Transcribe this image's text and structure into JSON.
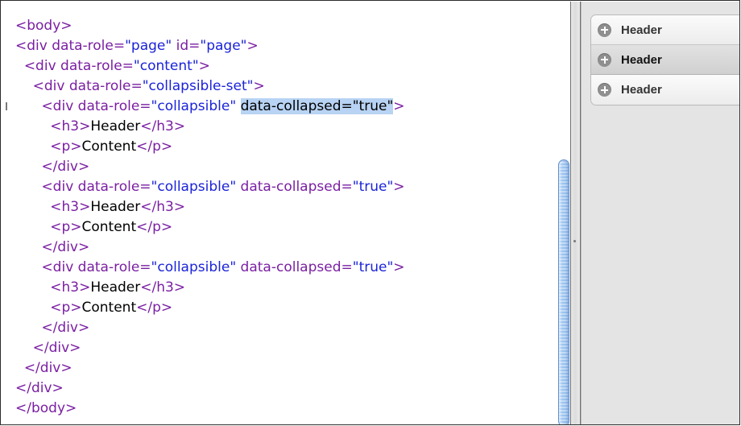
{
  "editor": {
    "lines": [
      [
        {
          "t": "tag",
          "v": "<body>"
        }
      ],
      [
        {
          "t": "tag",
          "v": "<div "
        },
        {
          "t": "attr",
          "v": "data-role="
        },
        {
          "t": "val",
          "v": "\"page\""
        },
        {
          "t": "attr",
          "v": " id="
        },
        {
          "t": "val",
          "v": "\"page\""
        },
        {
          "t": "tag",
          "v": ">"
        }
      ],
      [
        {
          "t": "text",
          "v": "  "
        },
        {
          "t": "tag",
          "v": "<div "
        },
        {
          "t": "attr",
          "v": "data-role="
        },
        {
          "t": "val",
          "v": "\"content\""
        },
        {
          "t": "tag",
          "v": ">"
        }
      ],
      [
        {
          "t": "text",
          "v": "    "
        },
        {
          "t": "tag",
          "v": "<div "
        },
        {
          "t": "attr",
          "v": "data-role="
        },
        {
          "t": "val",
          "v": "\"collapsible-set\""
        },
        {
          "t": "tag",
          "v": ">"
        }
      ],
      [
        {
          "t": "text",
          "v": "      "
        },
        {
          "t": "tag",
          "v": "<div "
        },
        {
          "t": "attr",
          "v": "data-role="
        },
        {
          "t": "val",
          "v": "\"collapsible\""
        },
        {
          "t": "text",
          "v": " "
        },
        {
          "t": "sel",
          "v": "data-collapsed=\"true\""
        },
        {
          "t": "tag",
          "v": ">"
        }
      ],
      [
        {
          "t": "text",
          "v": "        "
        },
        {
          "t": "tag",
          "v": "<h3>"
        },
        {
          "t": "text",
          "v": "Header"
        },
        {
          "t": "tag",
          "v": "</h3>"
        }
      ],
      [
        {
          "t": "text",
          "v": "        "
        },
        {
          "t": "tag",
          "v": "<p>"
        },
        {
          "t": "text",
          "v": "Content"
        },
        {
          "t": "tag",
          "v": "</p>"
        }
      ],
      [
        {
          "t": "text",
          "v": "      "
        },
        {
          "t": "tag",
          "v": "</div>"
        }
      ],
      [
        {
          "t": "text",
          "v": "      "
        },
        {
          "t": "tag",
          "v": "<div "
        },
        {
          "t": "attr",
          "v": "data-role="
        },
        {
          "t": "val",
          "v": "\"collapsible\""
        },
        {
          "t": "attr",
          "v": " data-collapsed="
        },
        {
          "t": "val",
          "v": "\"true\""
        },
        {
          "t": "tag",
          "v": ">"
        }
      ],
      [
        {
          "t": "text",
          "v": "        "
        },
        {
          "t": "tag",
          "v": "<h3>"
        },
        {
          "t": "text",
          "v": "Header"
        },
        {
          "t": "tag",
          "v": "</h3>"
        }
      ],
      [
        {
          "t": "text",
          "v": "        "
        },
        {
          "t": "tag",
          "v": "<p>"
        },
        {
          "t": "text",
          "v": "Content"
        },
        {
          "t": "tag",
          "v": "</p>"
        }
      ],
      [
        {
          "t": "text",
          "v": "      "
        },
        {
          "t": "tag",
          "v": "</div>"
        }
      ],
      [
        {
          "t": "text",
          "v": "      "
        },
        {
          "t": "tag",
          "v": "<div "
        },
        {
          "t": "attr",
          "v": "data-role="
        },
        {
          "t": "val",
          "v": "\"collapsible\""
        },
        {
          "t": "attr",
          "v": " data-collapsed="
        },
        {
          "t": "val",
          "v": "\"true\""
        },
        {
          "t": "tag",
          "v": ">"
        }
      ],
      [
        {
          "t": "text",
          "v": "        "
        },
        {
          "t": "tag",
          "v": "<h3>"
        },
        {
          "t": "text",
          "v": "Header"
        },
        {
          "t": "tag",
          "v": "</h3>"
        }
      ],
      [
        {
          "t": "text",
          "v": "        "
        },
        {
          "t": "tag",
          "v": "<p>"
        },
        {
          "t": "text",
          "v": "Content"
        },
        {
          "t": "tag",
          "v": "</p>"
        }
      ],
      [
        {
          "t": "text",
          "v": "      "
        },
        {
          "t": "tag",
          "v": "</div>"
        }
      ],
      [
        {
          "t": "text",
          "v": "    "
        },
        {
          "t": "tag",
          "v": "</div>"
        }
      ],
      [
        {
          "t": "text",
          "v": "  "
        },
        {
          "t": "tag",
          "v": "</div>"
        }
      ],
      [
        {
          "t": "tag",
          "v": "</div>"
        }
      ],
      [
        {
          "t": "tag",
          "v": "</body>"
        }
      ]
    ],
    "selected_text": "data-collapsed=\"true\""
  },
  "preview": {
    "collapsibles": [
      {
        "heading": "Header",
        "icon": "plus-icon",
        "state": "collapsed"
      },
      {
        "heading": "Header",
        "icon": "plus-icon",
        "state": "collapsed-hover"
      },
      {
        "heading": "Header",
        "icon": "plus-icon",
        "state": "collapsed"
      }
    ]
  },
  "colors": {
    "tag": "#7a1fa2",
    "attribute_value": "#1b23d8",
    "selection": "#b8d3f3",
    "scroll_thumb": "#9cc3ef"
  }
}
